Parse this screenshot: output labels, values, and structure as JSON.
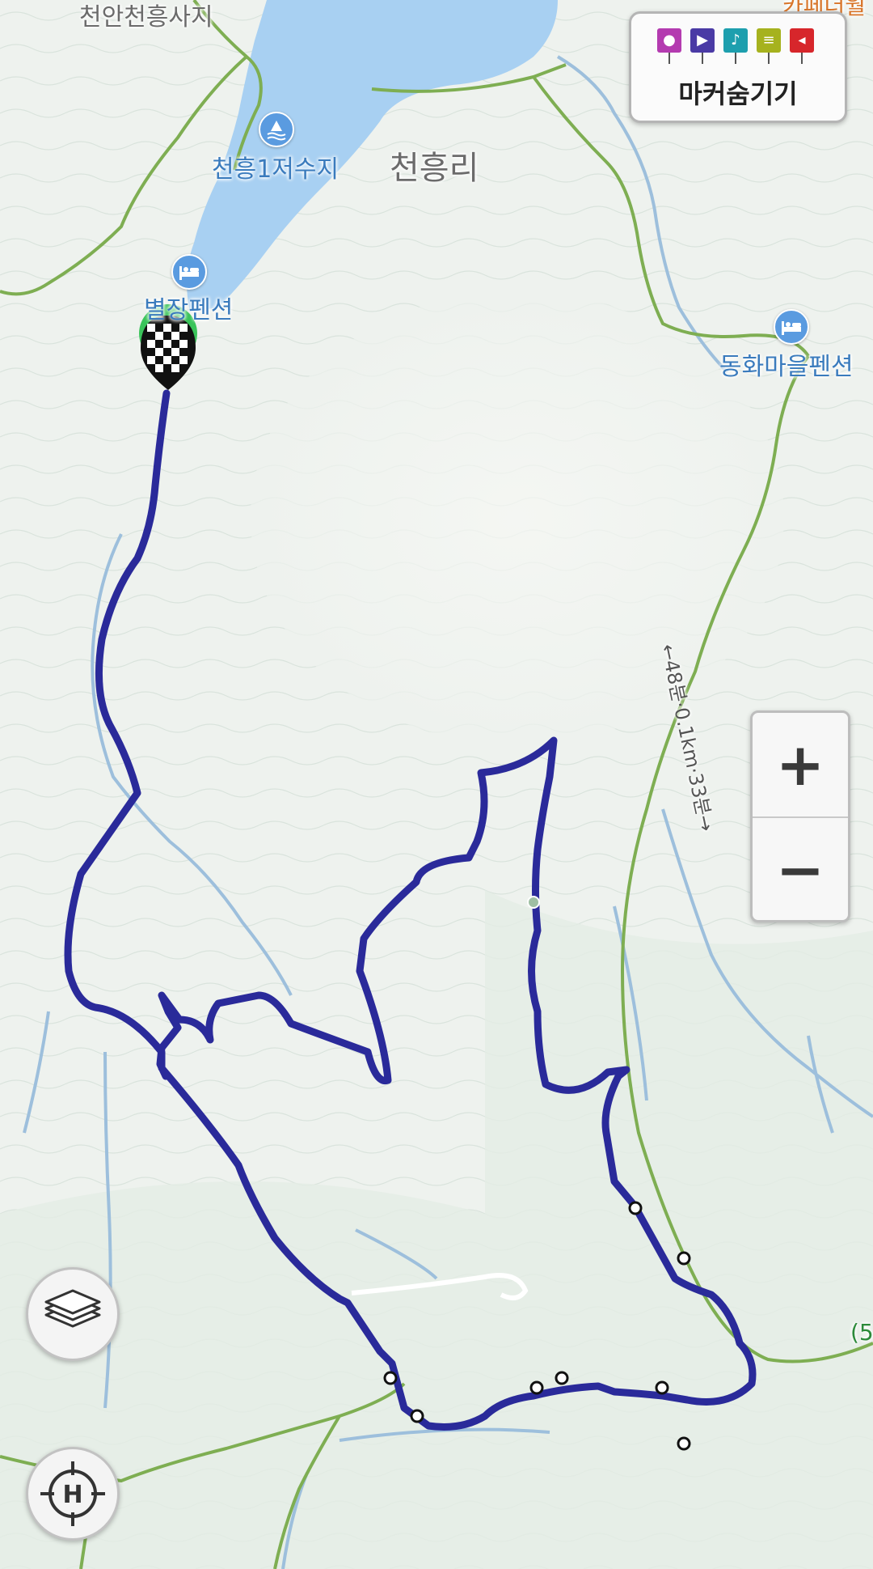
{
  "map": {
    "labels": {
      "village": "천흥리",
      "reservoir": "천흥1저수지",
      "temple_site": "천안천흥사지",
      "pension_1": "별장펜션",
      "pension_2": "동화마을펜션",
      "cafe": "카페더월",
      "trail_info": "←48분·0.1km·33분→",
      "edge_text": "(5"
    },
    "colors": {
      "track": "#2a2a9a",
      "water": "#a8d0f2",
      "stream": "#9dbfdc",
      "road_green": "#7eae52",
      "poi": "#5a9be0",
      "terrain": "#eef2ee"
    }
  },
  "marker_toggle": {
    "label": "마커숨기기",
    "icons": [
      {
        "name": "camera-marker-icon",
        "color": "#b43bb0"
      },
      {
        "name": "video-marker-icon",
        "color": "#4a3aa5"
      },
      {
        "name": "audio-marker-icon",
        "color": "#1d9fae"
      },
      {
        "name": "memo-marker-icon",
        "color": "#a6b21e"
      },
      {
        "name": "flag-marker-icon",
        "color": "#d7262b"
      }
    ]
  },
  "zoom": {
    "in_label": "+",
    "out_label": "−"
  },
  "controls": {
    "layers_icon": "layers-icon",
    "locate_icon": "crosshair-h-icon",
    "locate_label": "H"
  }
}
